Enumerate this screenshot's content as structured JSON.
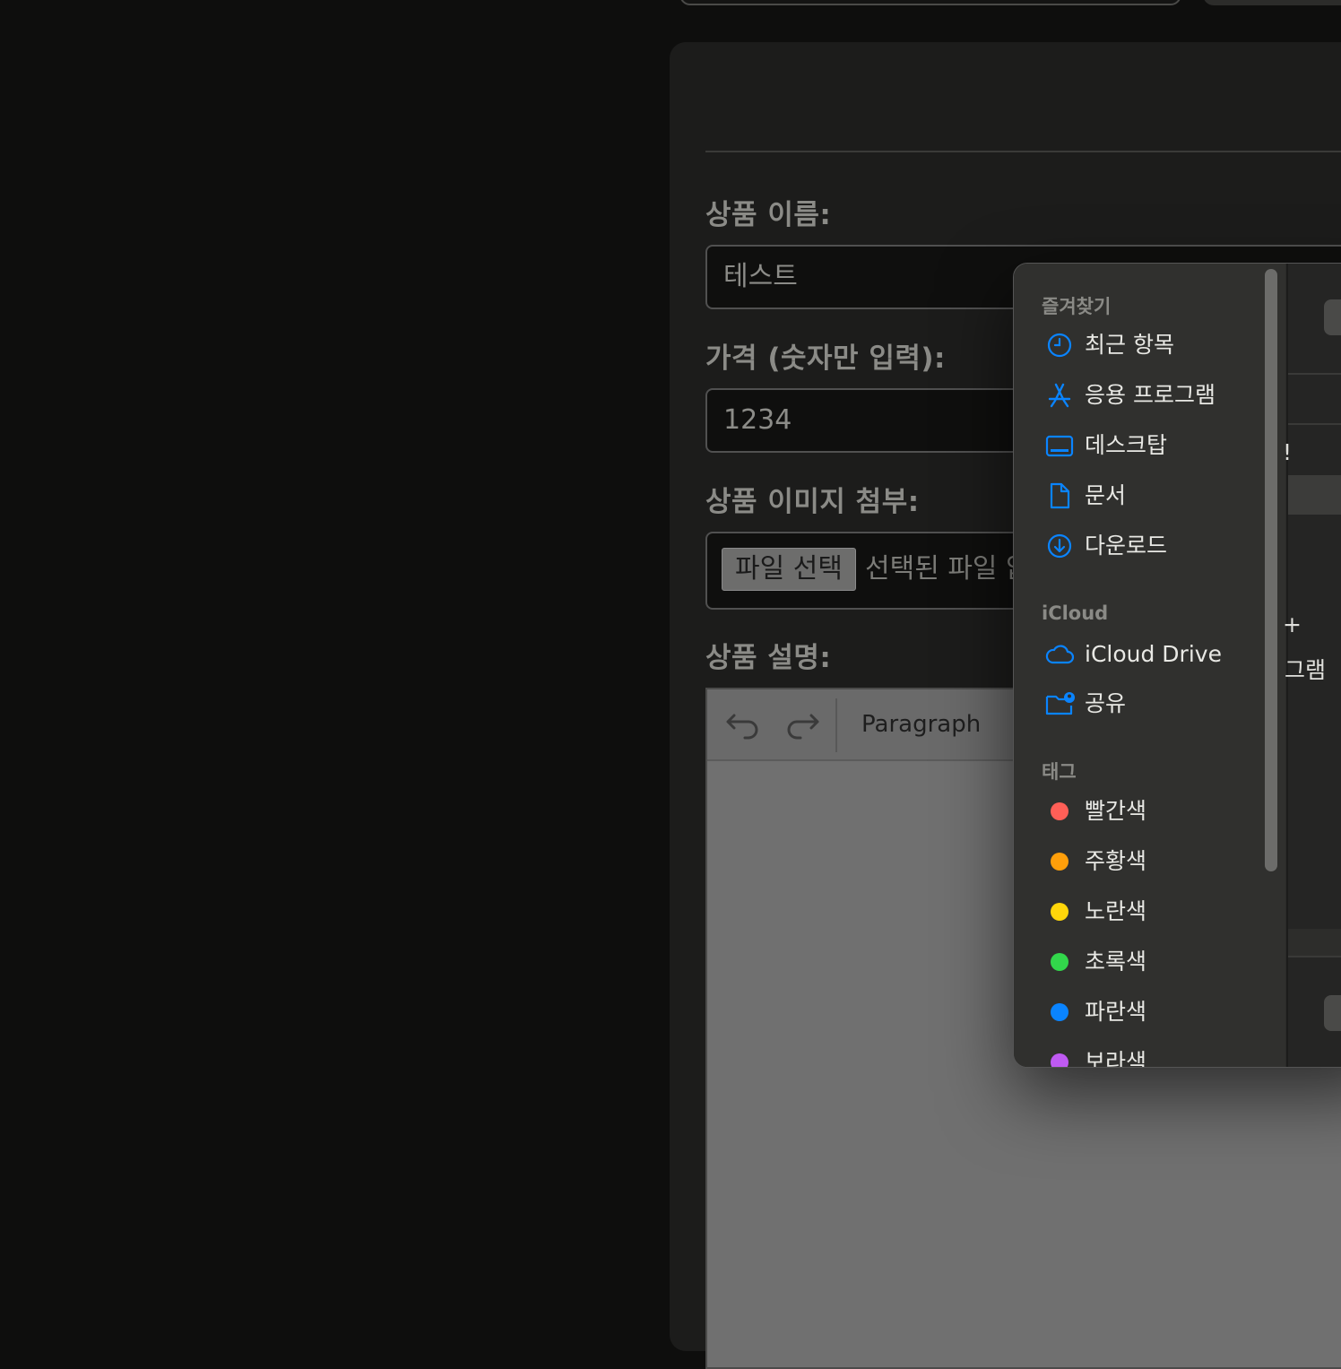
{
  "form": {
    "name_label": "상품 이름:",
    "name_value": "테스트",
    "price_label": "가격 (숫자만 입력):",
    "price_value": "1234",
    "image_label": "상품 이미지 첨부:",
    "file_button": "파일 선택",
    "file_status": "선택된 파일 없음",
    "desc_label": "상품 설명:",
    "editor_block_style": "Paragraph"
  },
  "dialog": {
    "favorites_heading": "즐겨찾기",
    "favorites": [
      {
        "label": "최근 항목",
        "icon": "clock-icon"
      },
      {
        "label": "응용 프로그램",
        "icon": "app-store-icon"
      },
      {
        "label": "데스크탑",
        "icon": "desktop-icon"
      },
      {
        "label": "문서",
        "icon": "document-icon"
      },
      {
        "label": "다운로드",
        "icon": "download-icon"
      }
    ],
    "icloud_heading": "iCloud",
    "icloud": [
      {
        "label": "iCloud Drive",
        "icon": "cloud-icon"
      },
      {
        "label": "공유",
        "icon": "shared-folder-icon"
      }
    ],
    "tags_heading": "태그",
    "tags": [
      {
        "label": "빨간색",
        "color": "#ff5f57"
      },
      {
        "label": "주황색",
        "color": "#ff9f0a"
      },
      {
        "label": "노란색",
        "color": "#ffd60a"
      },
      {
        "label": "초록색",
        "color": "#32d74b"
      },
      {
        "label": "파란색",
        "color": "#0a84ff"
      },
      {
        "label": "보라색",
        "color": "#bf5af2"
      }
    ],
    "right_fragments": [
      "!",
      "+",
      "그램"
    ],
    "accent": "#0a84ff"
  }
}
